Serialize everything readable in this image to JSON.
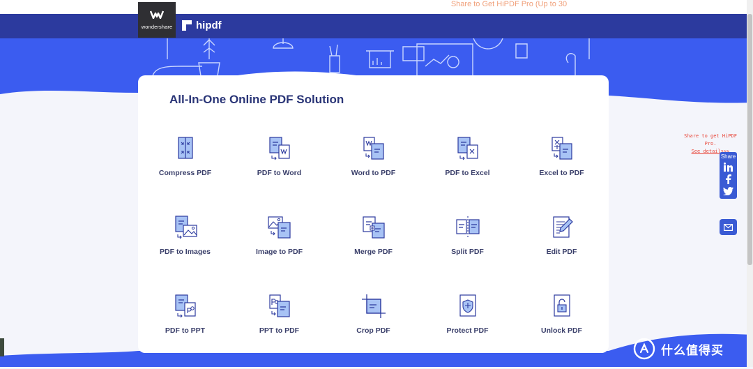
{
  "promo": {
    "text": "Share to Get HiPDF Pro (Up to 30"
  },
  "header": {
    "wondershare_logo_text": "wondershare",
    "hipdf_logo_text": "hipdf"
  },
  "main": {
    "headline": "All-In-One Online PDF Solution"
  },
  "tools": [
    {
      "label": "Compress PDF",
      "icon": "compress-pdf-icon"
    },
    {
      "label": "PDF to Word",
      "icon": "pdf-to-word-icon"
    },
    {
      "label": "Word to PDF",
      "icon": "word-to-pdf-icon"
    },
    {
      "label": "PDF to Excel",
      "icon": "pdf-to-excel-icon"
    },
    {
      "label": "Excel to PDF",
      "icon": "excel-to-pdf-icon"
    },
    {
      "label": "PDF to Images",
      "icon": "pdf-to-images-icon"
    },
    {
      "label": "Image to PDF",
      "icon": "image-to-pdf-icon"
    },
    {
      "label": "Merge PDF",
      "icon": "merge-pdf-icon"
    },
    {
      "label": "Split PDF",
      "icon": "split-pdf-icon"
    },
    {
      "label": "Edit PDF",
      "icon": "edit-pdf-icon"
    },
    {
      "label": "PDF to PPT",
      "icon": "pdf-to-ppt-icon"
    },
    {
      "label": "PPT to PDF",
      "icon": "ppt-to-pdf-icon"
    },
    {
      "label": "Crop PDF",
      "icon": "crop-pdf-icon"
    },
    {
      "label": "Protect PDF",
      "icon": "protect-pdf-icon"
    },
    {
      "label": "Unlock PDF",
      "icon": "unlock-pdf-icon"
    }
  ],
  "share_note": {
    "line1": "Share to get HiPDF",
    "line2": "Pro.",
    "link": "See details>>"
  },
  "share_panel": {
    "label": "Share",
    "icons": [
      "linkedin-icon",
      "facebook-icon",
      "twitter-icon"
    ]
  },
  "watermark": {
    "text": "什么值得买"
  },
  "colors": {
    "nav": "#2c3a9e",
    "hero": "#3b5cf0",
    "accent": "#3a5bd4",
    "icon_light": "#a8c3f5",
    "headline": "#2a3577"
  }
}
